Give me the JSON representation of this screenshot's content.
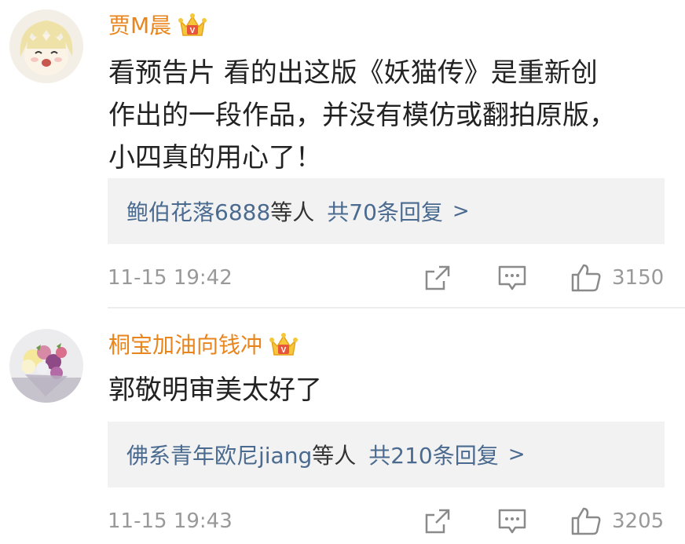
{
  "comments": [
    {
      "username": "贾M晨",
      "text": "看预告片 看的出这版《妖猫传》是重新创\n作出的一段作品，并没有模仿或翻拍原版，\n小四真的用心了！",
      "replies_users": "鲍伯花落6888",
      "replies_who": "等人",
      "replies_count": "共70条回复",
      "replies_arrow": ">",
      "timestamp": "11-15 19:42",
      "likes": "3150",
      "avatar_icon": "anime-avatar-icon",
      "vip_icon": "crown-vip-icon"
    },
    {
      "username": "桐宝加油向钱冲",
      "text": "郭敬明审美太好了",
      "replies_users": "佛系青年欧尼jiang",
      "replies_who": "等人",
      "replies_count": "共210条回复",
      "replies_arrow": ">",
      "timestamp": "11-15 19:43",
      "likes": "3205",
      "avatar_icon": "flower-bouquet-avatar-icon",
      "vip_icon": "crown-vip-icon"
    }
  ],
  "colors": {
    "username": "#e8851c",
    "link": "#4a6a90",
    "muted": "#999999",
    "reply_bg": "#f2f2f2"
  }
}
